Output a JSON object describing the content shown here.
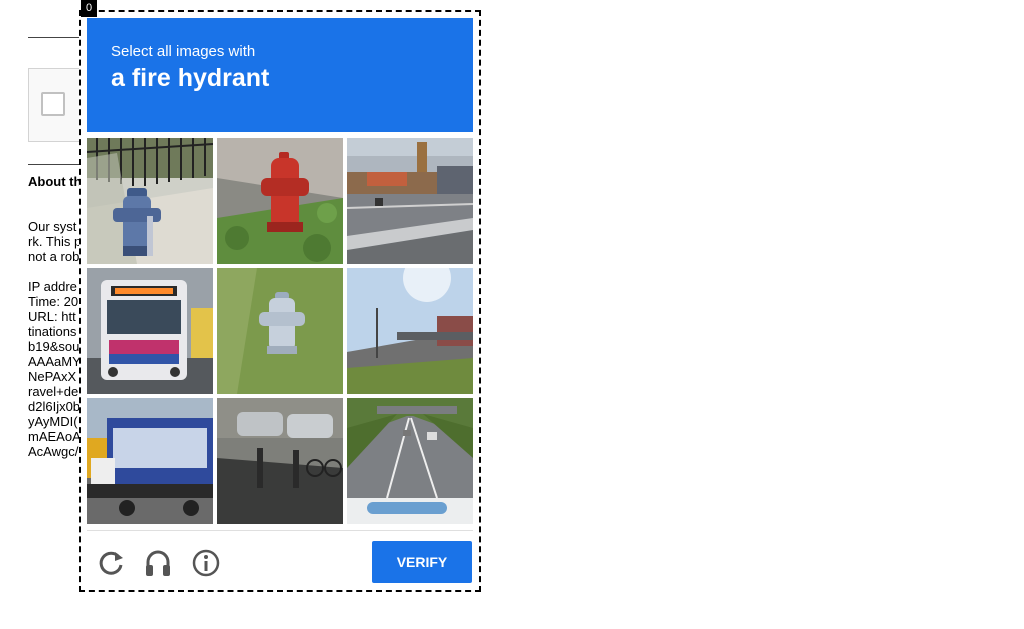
{
  "frame_tag": "0",
  "background": {
    "about_label": "About th",
    "paragraph_lines": [
      "Our syst",
      "rk. This p",
      "not a rob"
    ],
    "details_lines": [
      "IP addre",
      "Time: 20",
      "URL: htt",
      "tinations",
      "b19&sou",
      "AAAaMY",
      "NePAxX",
      "ravel+de",
      "d2l6Ijx0b",
      "yAyMDI(",
      "mAEAoA",
      "AcAwgc/"
    ]
  },
  "challenge": {
    "instruction_line1": "Select all images with",
    "instruction_line2": "a fire hydrant",
    "tiles": [
      {
        "subject": "fire-hydrant-blue-white-near-fence"
      },
      {
        "subject": "fire-hydrant-red-on-grass"
      },
      {
        "subject": "highway-with-buildings"
      },
      {
        "subject": "city-bus-in-traffic"
      },
      {
        "subject": "fire-hydrant-white-on-grass"
      },
      {
        "subject": "overpass-under-clear-sky"
      },
      {
        "subject": "flatbed-truck-in-street"
      },
      {
        "subject": "street-with-parked-cars-and-bicycles"
      },
      {
        "subject": "highway-view-from-car"
      }
    ],
    "verify_label": "VERIFY",
    "icons": {
      "reload": "reload-icon",
      "audio": "headphones-icon",
      "info": "info-icon"
    },
    "accent": "#1a73e8"
  }
}
